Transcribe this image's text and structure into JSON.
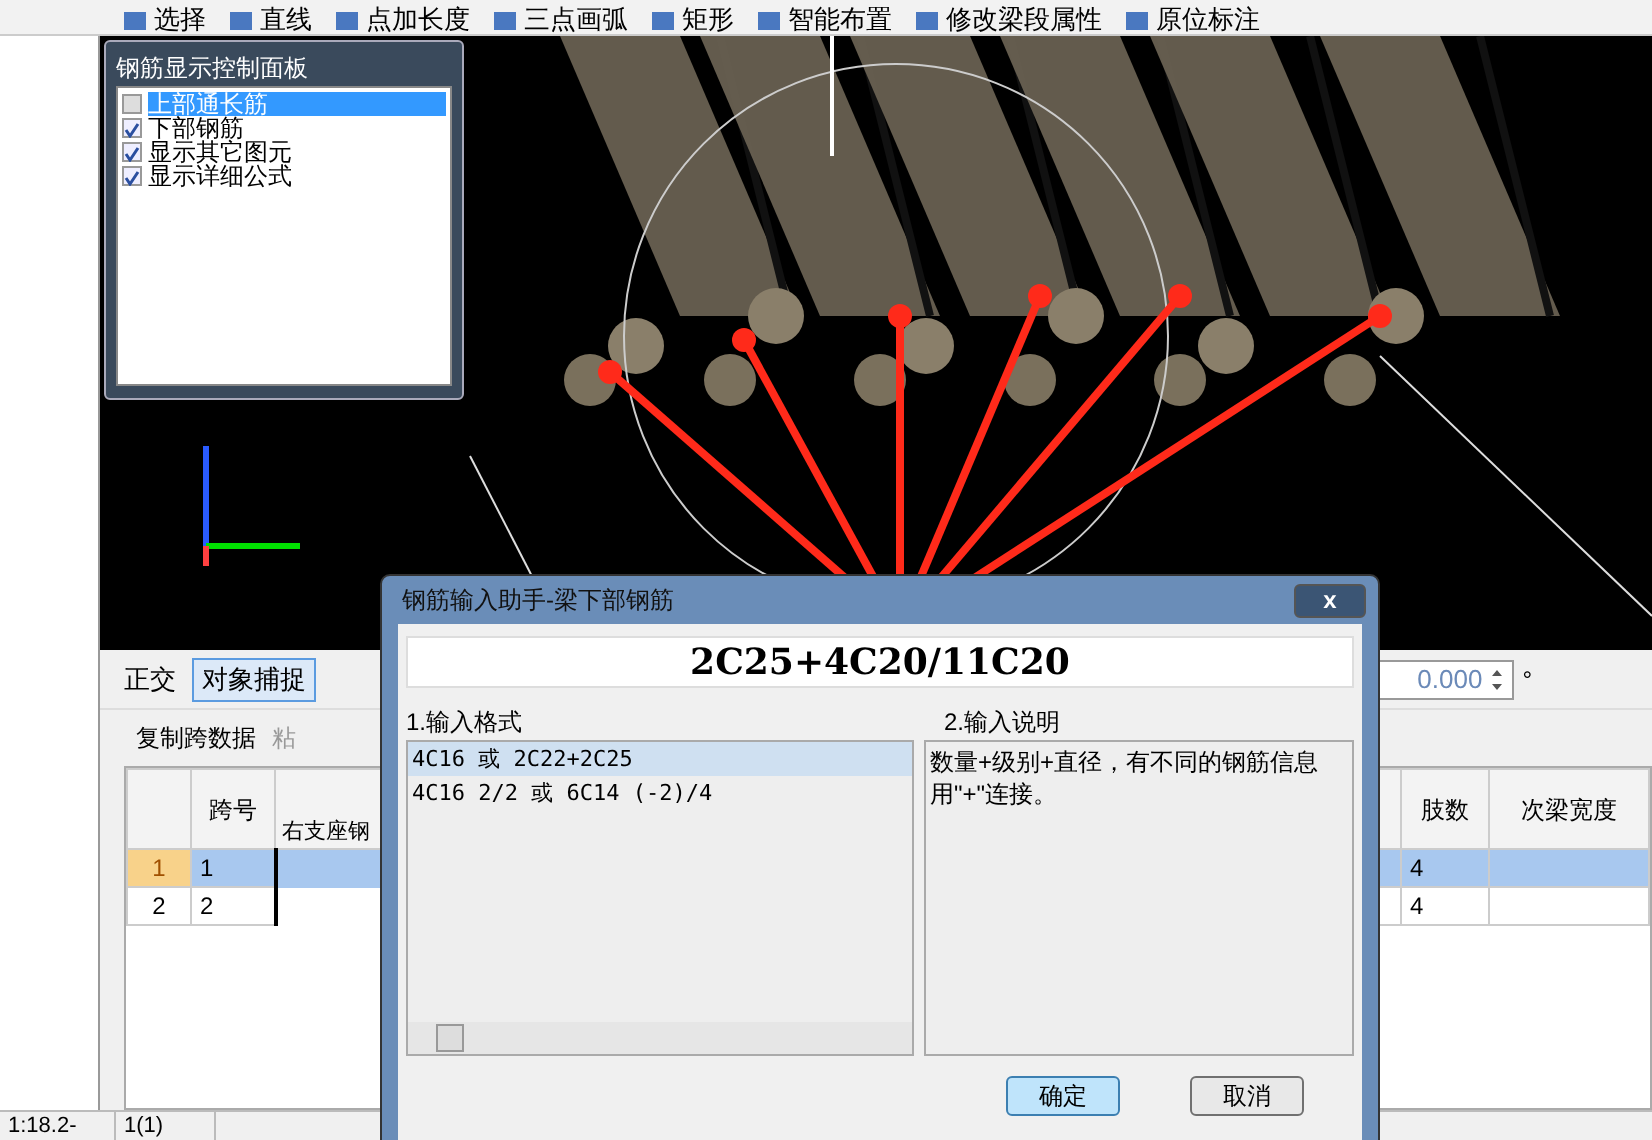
{
  "toolbar": {
    "items": [
      {
        "label": "选择"
      },
      {
        "label": "直线"
      },
      {
        "label": "点加长度"
      },
      {
        "label": "三点画弧"
      },
      {
        "label": "矩形"
      },
      {
        "label": "智能布置"
      },
      {
        "label": "修改梁段属性"
      },
      {
        "label": "原位标注"
      }
    ]
  },
  "display_panel": {
    "title": "钢筋显示控制面板",
    "items": [
      {
        "label": "上部通长筋",
        "checked": false,
        "selected": true
      },
      {
        "label": "下部钢筋",
        "checked": true,
        "selected": false
      },
      {
        "label": "显示其它图元",
        "checked": true,
        "selected": false
      },
      {
        "label": "显示详细公式",
        "checked": true,
        "selected": false
      }
    ]
  },
  "snap_toolbar": {
    "items": [
      {
        "label": "正交",
        "selected": false
      },
      {
        "label": "对象捕捉",
        "selected": true
      }
    ],
    "angle": "0.000",
    "unit": "°"
  },
  "grid_toolbar": {
    "items": [
      {
        "label": "复制跨数据",
        "disabled": false
      },
      {
        "label": "粘",
        "disabled": true
      }
    ]
  },
  "table": {
    "columns": [
      "跨号",
      "右支座钢",
      "肢数",
      "次梁宽度"
    ],
    "rows": [
      {
        "index": "1",
        "span": "1",
        "legs": "4",
        "selected": true
      },
      {
        "index": "2",
        "span": "2",
        "legs": "4",
        "selected": false
      }
    ]
  },
  "status_bar": [
    "1:18.2-",
    "1(1)"
  ],
  "dialog": {
    "title": "钢筋输入助手-梁下部钢筋",
    "close": "x",
    "value": "2C25+4C20/11C20",
    "format_label": "1.输入格式",
    "formats": [
      {
        "text": "4C16 或 2C22+2C25",
        "selected": true
      },
      {
        "text": "4C16 2/2 或 6C14 (-2)/4",
        "selected": false
      }
    ],
    "help_label": "2.输入说明",
    "help": "数量+级别+直径，有不同的钢筋信息用\"+\"连接。",
    "buttons": [
      {
        "label": "确定",
        "kind": "primary"
      },
      {
        "label": "取消",
        "kind": "normal"
      }
    ]
  }
}
